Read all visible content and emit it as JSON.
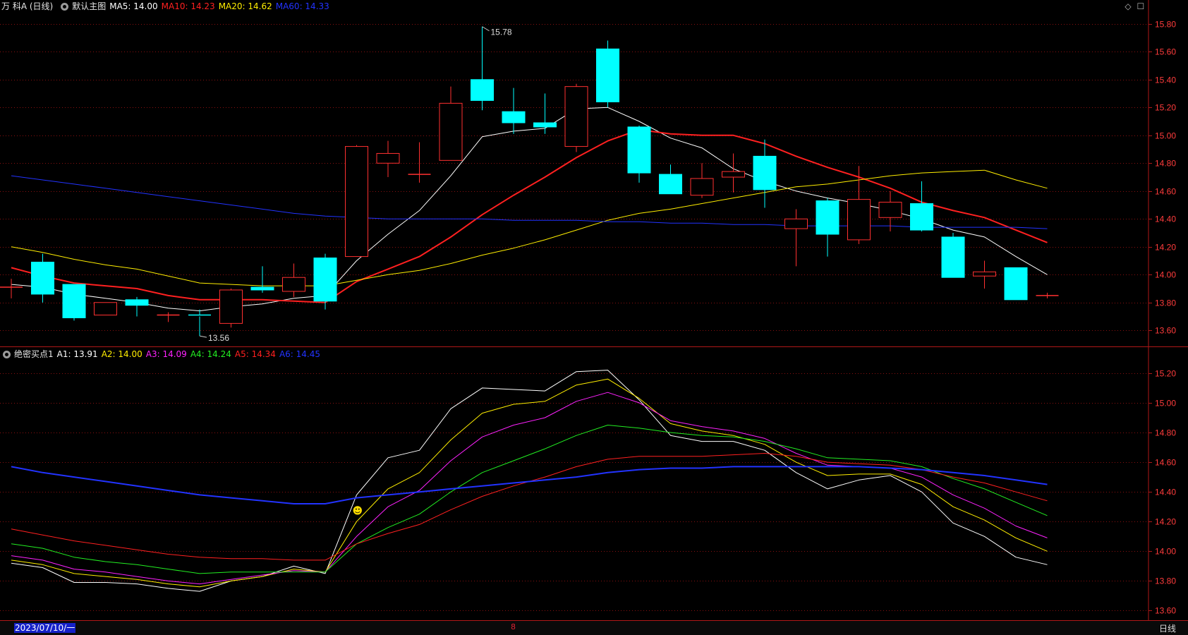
{
  "window": {
    "title": "万 科A (日线)"
  },
  "main": {
    "template": "默认主图",
    "ma": [
      {
        "label": "MA5: 14.00",
        "color": "#ffffff"
      },
      {
        "label": "MA10: 14.23",
        "color": "#ff2020"
      },
      {
        "label": "MA20: 14.62",
        "color": "#ffee00"
      },
      {
        "label": "MA60: 14.33",
        "color": "#2233ff"
      }
    ],
    "y_ticks": [
      "15.80",
      "15.60",
      "15.40",
      "15.20",
      "15.00",
      "14.80",
      "14.60",
      "14.40",
      "14.20",
      "14.00",
      "13.80",
      "13.60"
    ],
    "annotations": {
      "high": "15.78",
      "low": "13.56"
    }
  },
  "indicator": {
    "name": "绝密买点1",
    "lines": [
      {
        "label": "A1: 13.91",
        "color": "#ffffff"
      },
      {
        "label": "A2: 14.00",
        "color": "#ffee00"
      },
      {
        "label": "A3: 14.09",
        "color": "#ff22ff"
      },
      {
        "label": "A4: 14.24",
        "color": "#22ee22"
      },
      {
        "label": "A5: 14.34",
        "color": "#ff2020"
      },
      {
        "label": "A6: 14.45",
        "color": "#2233ff"
      }
    ],
    "y_ticks": [
      "15.20",
      "15.00",
      "14.80",
      "14.60",
      "14.40",
      "14.20",
      "14.00",
      "13.80",
      "13.60"
    ],
    "smiley": "☻"
  },
  "footer": {
    "date": "2023/07/10/一",
    "marker": "8",
    "period": "日线"
  },
  "colors": {
    "up": "#ff3030",
    "down": "#00ffff",
    "grid": "#8a1010",
    "axis": "#b01818",
    "label": "#ff3c3c"
  },
  "chart_data": [
    {
      "type": "candlestick",
      "title": "万 科A (日线)",
      "ylim": [
        13.5,
        15.88
      ],
      "candles": [
        {
          "o": 13.91,
          "h": 13.97,
          "l": 13.83,
          "c": 13.91
        },
        {
          "o": 14.09,
          "h": 14.15,
          "l": 13.8,
          "c": 13.86
        },
        {
          "o": 13.93,
          "h": 13.93,
          "l": 13.67,
          "c": 13.69
        },
        {
          "o": 13.71,
          "h": 13.8,
          "l": 13.71,
          "c": 13.8
        },
        {
          "o": 13.82,
          "h": 13.84,
          "l": 13.7,
          "c": 13.78
        },
        {
          "o": 13.71,
          "h": 13.73,
          "l": 13.66,
          "c": 13.71
        },
        {
          "o": 13.71,
          "h": 13.75,
          "l": 13.56,
          "c": 13.7
        },
        {
          "o": 13.65,
          "h": 13.9,
          "l": 13.62,
          "c": 13.89
        },
        {
          "o": 13.91,
          "h": 14.06,
          "l": 13.87,
          "c": 13.89
        },
        {
          "o": 13.88,
          "h": 14.08,
          "l": 13.84,
          "c": 13.98
        },
        {
          "o": 14.12,
          "h": 14.15,
          "l": 13.75,
          "c": 13.81
        },
        {
          "o": 14.13,
          "h": 14.93,
          "l": 14.13,
          "c": 14.92
        },
        {
          "o": 14.8,
          "h": 14.96,
          "l": 14.7,
          "c": 14.87
        },
        {
          "o": 14.72,
          "h": 14.95,
          "l": 14.66,
          "c": 14.72
        },
        {
          "o": 14.82,
          "h": 15.35,
          "l": 14.82,
          "c": 15.23
        },
        {
          "o": 15.4,
          "h": 15.78,
          "l": 15.18,
          "c": 15.25
        },
        {
          "o": 15.17,
          "h": 15.34,
          "l": 15.01,
          "c": 15.09
        },
        {
          "o": 15.09,
          "h": 15.3,
          "l": 15.01,
          "c": 15.06
        },
        {
          "o": 14.92,
          "h": 15.37,
          "l": 14.88,
          "c": 15.35
        },
        {
          "o": 15.62,
          "h": 15.68,
          "l": 15.2,
          "c": 15.24
        },
        {
          "o": 15.06,
          "h": 15.07,
          "l": 14.66,
          "c": 14.73
        },
        {
          "o": 14.72,
          "h": 14.79,
          "l": 14.58,
          "c": 14.58
        },
        {
          "o": 14.57,
          "h": 14.8,
          "l": 14.55,
          "c": 14.69
        },
        {
          "o": 14.7,
          "h": 14.87,
          "l": 14.59,
          "c": 14.74
        },
        {
          "o": 14.85,
          "h": 14.97,
          "l": 14.48,
          "c": 14.61
        },
        {
          "o": 14.33,
          "h": 14.47,
          "l": 14.06,
          "c": 14.4
        },
        {
          "o": 14.53,
          "h": 14.55,
          "l": 14.13,
          "c": 14.29
        },
        {
          "o": 14.25,
          "h": 14.78,
          "l": 14.22,
          "c": 14.54
        },
        {
          "o": 14.41,
          "h": 14.6,
          "l": 14.31,
          "c": 14.52
        },
        {
          "o": 14.51,
          "h": 14.67,
          "l": 14.31,
          "c": 14.32
        },
        {
          "o": 14.27,
          "h": 14.3,
          "l": 13.98,
          "c": 13.98
        },
        {
          "o": 13.99,
          "h": 14.1,
          "l": 13.9,
          "c": 14.02
        },
        {
          "o": 14.05,
          "h": 14.05,
          "l": 13.82,
          "c": 13.82
        },
        {
          "o": 13.85,
          "h": 13.87,
          "l": 13.83,
          "c": 13.85
        }
      ],
      "series": [
        {
          "name": "MA5",
          "color": "#ffffff",
          "width": 1,
          "values": [
            13.93,
            13.91,
            13.86,
            13.83,
            13.8,
            13.76,
            13.74,
            13.77,
            13.79,
            13.83,
            13.85,
            14.1,
            14.29,
            14.46,
            14.71,
            14.99,
            15.03,
            15.05,
            15.19,
            15.2,
            15.1,
            14.98,
            14.91,
            14.76,
            14.67,
            14.6,
            14.55,
            14.51,
            14.46,
            14.4,
            14.32,
            14.27,
            14.13,
            14.0
          ]
        },
        {
          "name": "MA10",
          "color": "#ff2020",
          "width": 2,
          "values": [
            14.05,
            13.99,
            13.94,
            13.92,
            13.9,
            13.85,
            13.82,
            13.82,
            13.82,
            13.81,
            13.8,
            13.95,
            14.04,
            14.13,
            14.27,
            14.43,
            14.57,
            14.7,
            14.84,
            14.96,
            15.04,
            15.01,
            15.0,
            15.0,
            14.94,
            14.85,
            14.77,
            14.7,
            14.62,
            14.52,
            14.46,
            14.41,
            14.32,
            14.23
          ]
        },
        {
          "name": "MA20",
          "color": "#ffee00",
          "width": 1,
          "values": [
            14.2,
            14.16,
            14.11,
            14.07,
            14.04,
            13.99,
            13.94,
            13.93,
            13.92,
            13.92,
            13.92,
            13.96,
            14.0,
            14.03,
            14.08,
            14.14,
            14.19,
            14.25,
            14.32,
            14.39,
            14.44,
            14.47,
            14.51,
            14.55,
            14.59,
            14.63,
            14.65,
            14.68,
            14.71,
            14.73,
            14.74,
            14.75,
            14.68,
            14.62
          ]
        },
        {
          "name": "MA60",
          "color": "#2233ff",
          "width": 1,
          "values": [
            14.71,
            14.68,
            14.65,
            14.62,
            14.59,
            14.56,
            14.53,
            14.5,
            14.47,
            14.44,
            14.42,
            14.41,
            14.4,
            14.4,
            14.4,
            14.4,
            14.39,
            14.39,
            14.39,
            14.38,
            14.38,
            14.37,
            14.37,
            14.36,
            14.36,
            14.35,
            14.35,
            14.35,
            14.35,
            14.34,
            14.34,
            14.34,
            14.34,
            14.33
          ]
        }
      ]
    },
    {
      "type": "line",
      "title": "绝密买点1",
      "ylim": [
        13.55,
        15.28
      ],
      "series": [
        {
          "name": "A1",
          "color": "#ffffff",
          "width": 1,
          "values": [
            13.92,
            13.89,
            13.79,
            13.79,
            13.78,
            13.75,
            13.73,
            13.8,
            13.83,
            13.9,
            13.85,
            14.38,
            14.63,
            14.68,
            14.96,
            15.1,
            15.09,
            15.08,
            15.21,
            15.22,
            15.02,
            14.78,
            14.74,
            14.74,
            14.68,
            14.53,
            14.42,
            14.48,
            14.51,
            14.4,
            14.19,
            14.1,
            13.96,
            13.91
          ]
        },
        {
          "name": "A2",
          "color": "#ffee00",
          "width": 1,
          "values": [
            13.94,
            13.91,
            13.85,
            13.83,
            13.81,
            13.78,
            13.76,
            13.8,
            13.83,
            13.88,
            13.86,
            14.2,
            14.42,
            14.53,
            14.75,
            14.93,
            14.99,
            15.01,
            15.12,
            15.16,
            15.03,
            14.86,
            14.81,
            14.78,
            14.72,
            14.6,
            14.51,
            14.52,
            14.52,
            14.45,
            14.3,
            14.21,
            14.09,
            14.0
          ]
        },
        {
          "name": "A3",
          "color": "#ff22ff",
          "width": 1,
          "values": [
            13.97,
            13.94,
            13.88,
            13.86,
            13.83,
            13.8,
            13.78,
            13.81,
            13.84,
            13.87,
            13.86,
            14.1,
            14.3,
            14.41,
            14.61,
            14.77,
            14.85,
            14.9,
            15.01,
            15.07,
            15.0,
            14.88,
            14.84,
            14.81,
            14.76,
            14.66,
            14.58,
            14.57,
            14.56,
            14.5,
            14.38,
            14.29,
            14.17,
            14.09
          ]
        },
        {
          "name": "A4",
          "color": "#22ee22",
          "width": 1,
          "values": [
            14.05,
            14.02,
            13.96,
            13.93,
            13.91,
            13.88,
            13.85,
            13.86,
            13.86,
            13.86,
            13.86,
            14.05,
            14.16,
            14.25,
            14.4,
            14.53,
            14.61,
            14.69,
            14.78,
            14.85,
            14.83,
            14.8,
            14.78,
            14.77,
            14.74,
            14.69,
            14.63,
            14.62,
            14.61,
            14.57,
            14.49,
            14.42,
            14.33,
            14.24
          ]
        },
        {
          "name": "A5",
          "color": "#ff2020",
          "width": 1,
          "values": [
            14.15,
            14.11,
            14.07,
            14.04,
            14.01,
            13.98,
            13.96,
            13.95,
            13.95,
            13.94,
            13.94,
            14.05,
            14.12,
            14.18,
            14.28,
            14.37,
            14.44,
            14.5,
            14.57,
            14.62,
            14.64,
            14.64,
            14.64,
            14.65,
            14.66,
            14.64,
            14.6,
            14.59,
            14.58,
            14.55,
            14.5,
            14.46,
            14.4,
            14.34
          ]
        },
        {
          "name": "A6",
          "color": "#2233ff",
          "width": 2,
          "values": [
            14.57,
            14.53,
            14.5,
            14.47,
            14.44,
            14.41,
            14.38,
            14.36,
            14.34,
            14.32,
            14.32,
            14.36,
            14.38,
            14.4,
            14.42,
            14.44,
            14.46,
            14.48,
            14.5,
            14.53,
            14.55,
            14.56,
            14.56,
            14.57,
            14.57,
            14.57,
            14.57,
            14.57,
            14.56,
            14.55,
            14.53,
            14.51,
            14.48,
            14.45
          ]
        }
      ]
    }
  ]
}
